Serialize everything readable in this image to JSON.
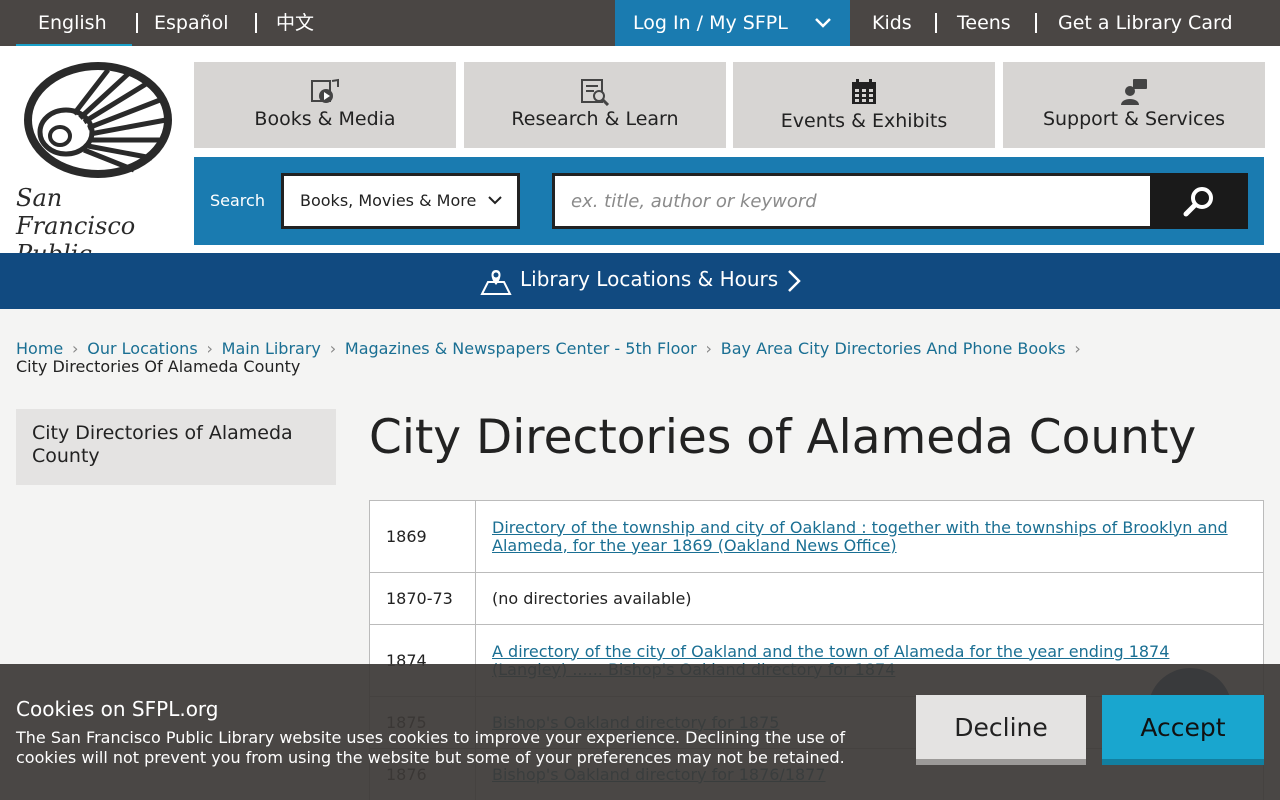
{
  "languages": {
    "english": "English",
    "espanol": "Español",
    "chinese": "中文"
  },
  "top_links": {
    "login": "Log In / My SFPL",
    "kids": "Kids",
    "teens": "Teens",
    "library_card": "Get a Library Card"
  },
  "logo": {
    "line1": "San Francisco",
    "line2": "Public Library"
  },
  "nav_tiles": [
    {
      "label": "Books & Media",
      "icon": "media-icon"
    },
    {
      "label": "Research & Learn",
      "icon": "research-icon"
    },
    {
      "label": "Events & Exhibits",
      "icon": "calendar-icon"
    },
    {
      "label": "Support & Services",
      "icon": "support-person-icon"
    }
  ],
  "search": {
    "label": "Search",
    "scope": "Books, Movies & More",
    "placeholder": "ex. title, author or keyword"
  },
  "locations": {
    "label": "Library Locations & Hours"
  },
  "breadcrumb": {
    "items": [
      "Home",
      "Our Locations",
      "Main Library",
      "Magazines & Newspapers Center - 5th Floor",
      "Bay Area City Directories And Phone Books"
    ],
    "current": "City Directories Of Alameda County"
  },
  "sidebar": {
    "item": "City Directories of Alameda County"
  },
  "main": {
    "title": "City Directories of Alameda County"
  },
  "directories": [
    {
      "year": "1869",
      "text": "Directory of the township and city of Oakland : together with the townships of Brooklyn and Alameda, for the year 1869 (Oakland News Office)",
      "link": true
    },
    {
      "year": "1870-73",
      "text": "(no directories available)",
      "link": false
    },
    {
      "year": "1874",
      "text": "A directory of the city of Oakland and the town of Alameda for the year ending 1874 (Langley) ...... Bishop's Oakland directory for 1874",
      "link": true
    },
    {
      "year": "1875",
      "text": "Bishop's Oakland directory for 1875",
      "link": true
    },
    {
      "year": "1876",
      "text": "Bishop's Oakland directory for 1876/1877",
      "link": true
    }
  ],
  "cookie": {
    "title": "Cookies on SFPL.org",
    "text": "The San Francisco Public Library website uses cookies to improve your experience. Declining the use of cookies will not prevent you from using the website but some of your preferences may not be retained.",
    "decline": "Decline",
    "accept": "Accept"
  },
  "colors": {
    "topbar": "#4a4644",
    "brand_blue": "#1a7bb0",
    "locations_blue": "#114a80",
    "accent_cyan": "#19a6cf",
    "tile_gray": "#d7d5d3"
  }
}
